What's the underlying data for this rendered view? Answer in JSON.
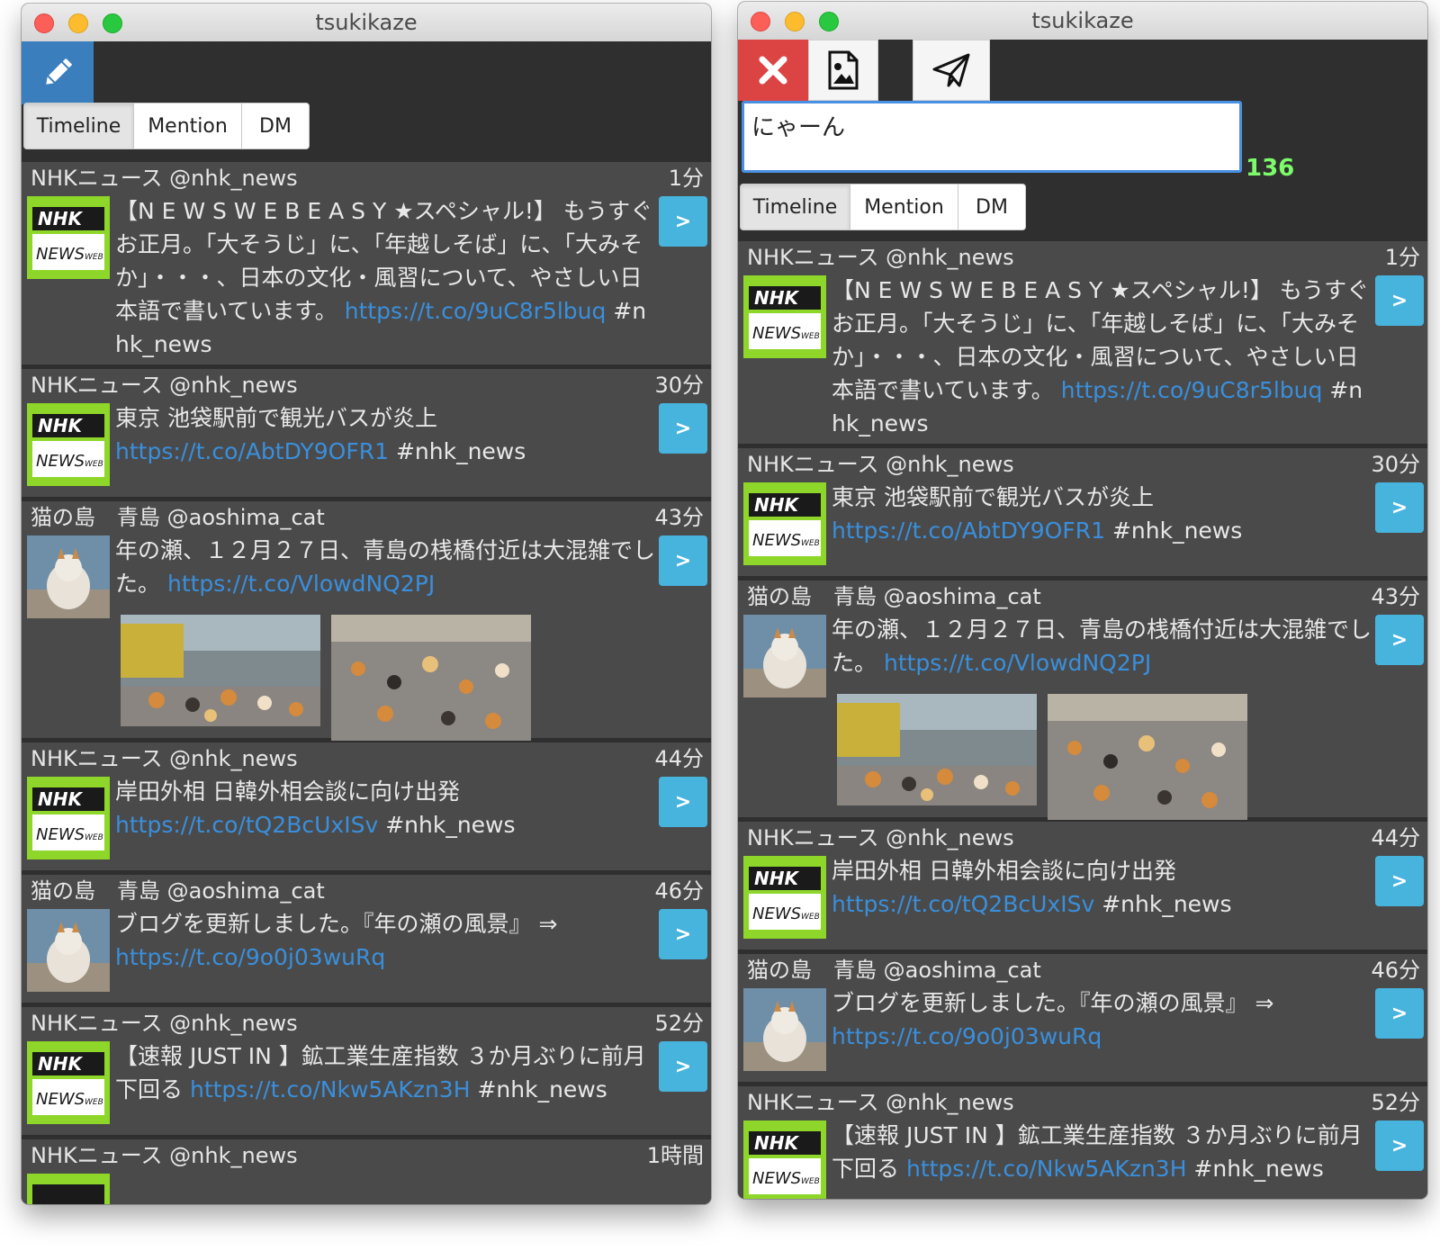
{
  "left_window": {
    "title": "tsukikaze",
    "tabs": [
      "Timeline",
      "Mention",
      "DM"
    ]
  },
  "right_window": {
    "title": "tsukikaze",
    "tweet_input_value": "にゃーん",
    "remaining_chars": "136",
    "tabs": [
      "Timeline",
      "Mention",
      "DM"
    ]
  },
  "icons": {
    "compose": "pencil-icon",
    "cancel": "close-icon",
    "image": "image-icon",
    "send": "paper-plane-icon",
    "detail": ">"
  },
  "colors": {
    "compose_bg": "#3a7ebd",
    "cancel_bg": "#dc4444",
    "detail_bg": "#47b4de",
    "link": "#3a8fdc",
    "counter": "#7cfc6a"
  },
  "tweets": [
    {
      "user": "NHKニュース @nhk_news",
      "time": "1分",
      "text": "【N E W S  W E B  E A S Y ★スペシャル!】 もうすぐお正月。「大そうじ」に、「年越しそば」に、「大みそか」・・・、日本の文化・風習について、やさしい日本語で書いています。",
      "link": "https://t.co/9uC8r5lbuq",
      "tag": "#nhk_news"
    },
    {
      "user": "NHKニュース @nhk_news",
      "time": "30分",
      "text": "東京 池袋駅前で観光バスが炎上",
      "link": "https://t.co/AbtDY9OFR1",
      "tag": "#nhk_news"
    },
    {
      "user": "猫の島　青島 @aoshima_cat",
      "time": "43分",
      "text": "年の瀬、１２月２７日、青島の桟橋付近は大混雑でした。",
      "link": "https://t.co/VlowdNQ2PJ",
      "tag": ""
    },
    {
      "user": "NHKニュース @nhk_news",
      "time": "44分",
      "text": "岸田外相 日韓外相会談に向け出発",
      "link": "https://t.co/tQ2BcUxISv",
      "tag": "#nhk_news"
    },
    {
      "user": "猫の島　青島 @aoshima_cat",
      "time": "46分",
      "text": "ブログを更新しました。『年の瀬の風景』 ⇒",
      "link": "https://t.co/9o0j03wuRq",
      "tag": ""
    },
    {
      "user": "NHKニュース @nhk_news",
      "time": "52分",
      "text": "【速報 JUST IN 】鉱工業生産指数 ３か月ぶりに前月下回る",
      "link": "https://t.co/Nkw5AKzn3H",
      "tag": "#nhk_news"
    },
    {
      "user": "NHKニュース @nhk_news",
      "time": "1時間",
      "text": "",
      "link": "",
      "tag": ""
    }
  ]
}
